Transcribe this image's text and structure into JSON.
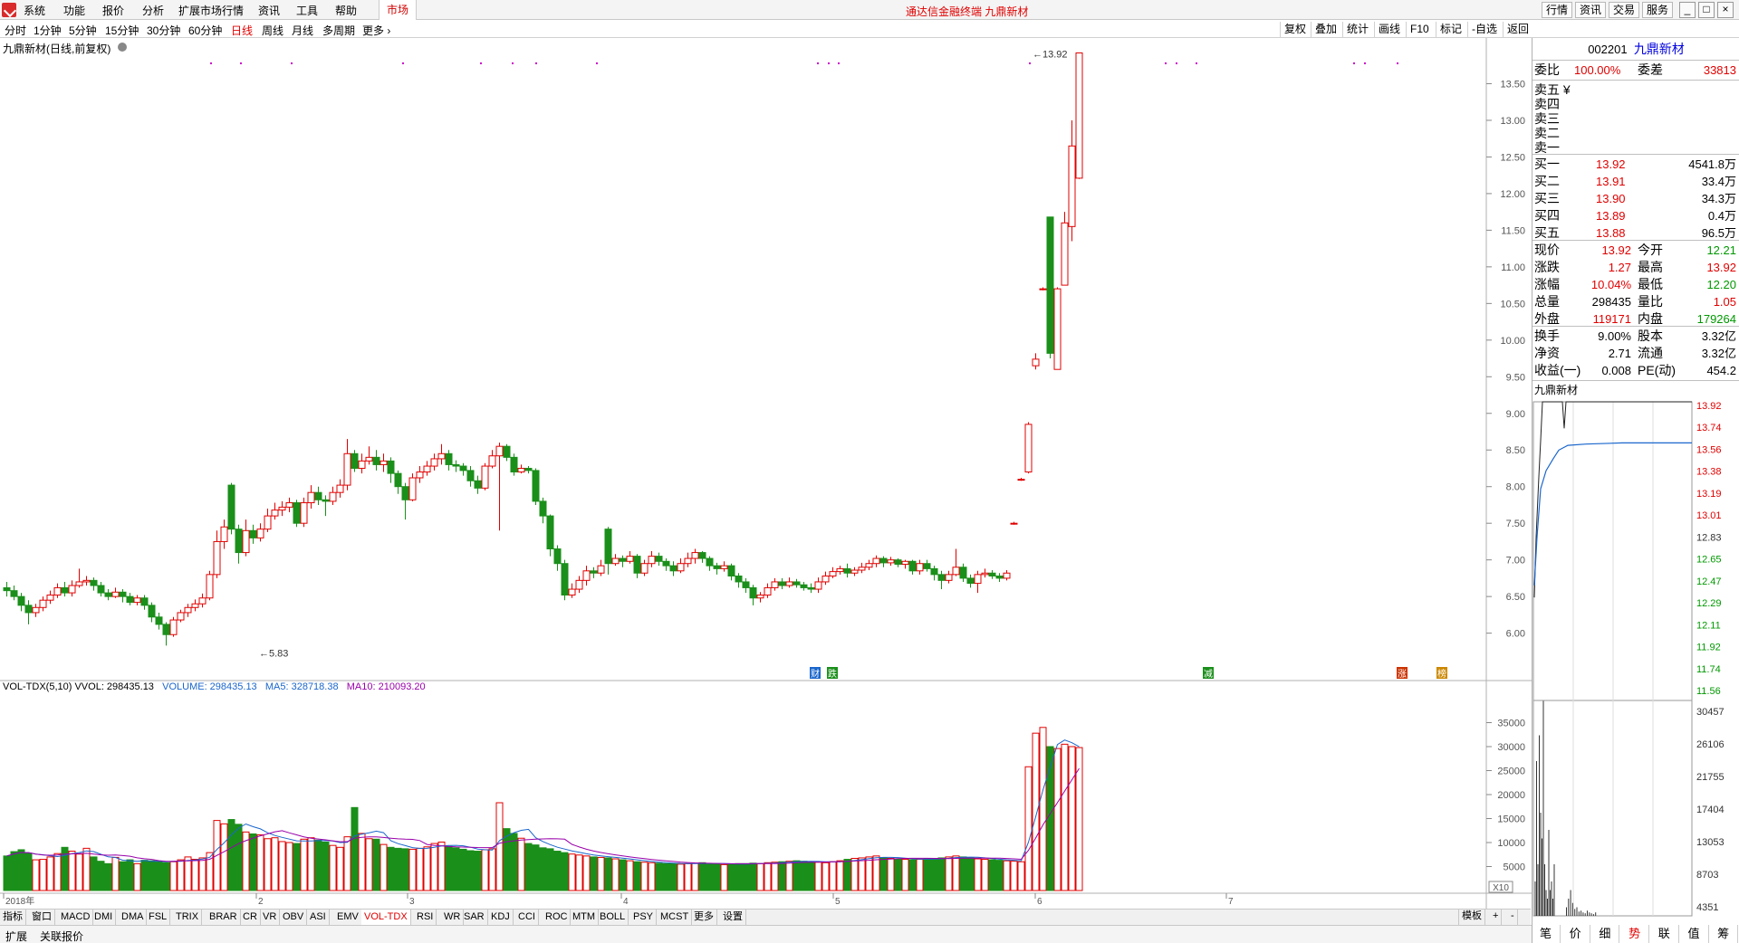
{
  "app": {
    "title": "通达信金融终端 九鼎新材",
    "menus": [
      "系统",
      "功能",
      "报价",
      "分析",
      "扩展市场行情",
      "资讯",
      "工具",
      "帮助"
    ],
    "market_tab": "市场",
    "top_buttons": [
      "行情",
      "资讯",
      "交易",
      "服务"
    ],
    "window_buttons": [
      "_",
      "□",
      "×"
    ]
  },
  "periods": [
    "分时",
    "1分钟",
    "5分钟",
    "15分钟",
    "30分钟",
    "60分钟",
    "日线",
    "周线",
    "月线",
    "多周期",
    "更多"
  ],
  "active_period": "日线",
  "right_tools": [
    "复权",
    "叠加",
    "统计",
    "画线",
    "F10",
    "标记",
    "-自选",
    "返回"
  ],
  "chart": {
    "title": "九鼎新材(日线,前复权)",
    "high_marker": "13.92",
    "low_marker": "5.83",
    "y_ticks": [
      "13.50",
      "13.00",
      "12.50",
      "12.00",
      "11.50",
      "11.00",
      "10.50",
      "10.00",
      "9.50",
      "9.00",
      "8.50",
      "8.00",
      "7.50",
      "7.00",
      "6.50",
      "6.00"
    ],
    "x_labels": [
      "2018年",
      "2",
      "3",
      "4",
      "5",
      "6",
      "7"
    ],
    "event_markers": [
      "财",
      "跌",
      "减",
      "涨",
      "榜"
    ],
    "up_color": "#e00000",
    "down_color": "#1a8f1a"
  },
  "volume": {
    "legend_name": "VOL-TDX(5,10) VVOL: 298435.13",
    "legend_volume": "VOLUME: 298435.13",
    "legend_ma5": "MA5: 328718.38",
    "legend_ma10": "MA10: 210093.20",
    "y_ticks": [
      "35000",
      "30000",
      "25000",
      "20000",
      "15000",
      "10000",
      "5000"
    ],
    "unit": "X10",
    "ma5_color": "#1a66cc",
    "ma10_color": "#9900aa"
  },
  "bottom_tabs": [
    "指标",
    "窗口",
    "MACD",
    "DMI",
    "DMA",
    "FSL",
    "TRIX",
    "BRAR",
    "CR",
    "VR",
    "OBV",
    "ASI",
    "EMV",
    "VOL-TDX",
    "RSI",
    "WR",
    "SAR",
    "KDJ",
    "CCI",
    "ROC",
    "MTM",
    "BOLL",
    "PSY",
    "MCST",
    "更多",
    "设置"
  ],
  "active_bottom_tab": "VOL-TDX",
  "bottom_right": [
    "模板",
    "+",
    "-"
  ],
  "status_tabs": [
    "扩展",
    "关联报价"
  ],
  "quote": {
    "code": "002201",
    "name": "九鼎新材",
    "webi_label": "委比",
    "webi": "100.00%",
    "weicha_label": "委差",
    "weicha": "33813",
    "asks": [
      {
        "label": "卖五",
        "extra": "¥"
      },
      {
        "label": "卖四"
      },
      {
        "label": "卖三"
      },
      {
        "label": "卖二"
      },
      {
        "label": "卖一"
      }
    ],
    "bids": [
      {
        "label": "买一",
        "price": "13.92",
        "vol": "4541.8万"
      },
      {
        "label": "买二",
        "price": "13.91",
        "vol": "33.4万"
      },
      {
        "label": "买三",
        "price": "13.90",
        "vol": "34.3万"
      },
      {
        "label": "买四",
        "price": "13.89",
        "vol": "0.4万"
      },
      {
        "label": "买五",
        "price": "13.88",
        "vol": "96.5万"
      }
    ],
    "stats": [
      {
        "l1": "现价",
        "v1": "13.92",
        "c1": "red",
        "l2": "今开",
        "v2": "12.21",
        "c2": "green"
      },
      {
        "l1": "涨跌",
        "v1": "1.27",
        "c1": "red",
        "l2": "最高",
        "v2": "13.92",
        "c2": "red"
      },
      {
        "l1": "涨幅",
        "v1": "10.04%",
        "c1": "red",
        "l2": "最低",
        "v2": "12.20",
        "c2": "green"
      },
      {
        "l1": "总量",
        "v1": "298435",
        "c1": "black",
        "l2": "量比",
        "v2": "1.05",
        "c2": "red"
      },
      {
        "l1": "外盘",
        "v1": "119171",
        "c1": "red",
        "l2": "内盘",
        "v2": "179264",
        "c2": "green"
      }
    ],
    "stats2": [
      {
        "l1": "换手",
        "v1": "9.00%",
        "l2": "股本",
        "v2": "3.32亿"
      },
      {
        "l1": "净资",
        "v1": "2.71",
        "l2": "流通",
        "v2": "3.32亿"
      },
      {
        "l1": "收益(一)",
        "v1": "0.008",
        "l2": "PE(动)",
        "v2": "454.2"
      }
    ]
  },
  "mini_chart": {
    "title": "九鼎新材",
    "price_ticks": [
      "13.92",
      "13.74",
      "13.56",
      "13.38",
      "13.19",
      "13.01",
      "12.83",
      "12.65",
      "12.47",
      "12.29",
      "12.11",
      "11.92",
      "11.74",
      "11.56"
    ],
    "vol_ticks": [
      "30457",
      "26106",
      "21755",
      "17404",
      "13053",
      "8703",
      "4351"
    ],
    "tabs": [
      "笔",
      "价",
      "细",
      "势",
      "联",
      "值",
      "筹"
    ],
    "active_tab": "势"
  },
  "chart_data": {
    "type": "candlestick",
    "title": "九鼎新材(日线,前复权)",
    "ylim": [
      5.6,
      14.0
    ],
    "candles": [
      [
        6.62,
        6.58,
        6.7,
        6.5
      ],
      [
        6.58,
        6.5,
        6.65,
        6.45
      ],
      [
        6.5,
        6.38,
        6.55,
        6.3
      ],
      [
        6.38,
        6.28,
        6.45,
        6.12
      ],
      [
        6.28,
        6.35,
        6.4,
        6.22
      ],
      [
        6.35,
        6.45,
        6.5,
        6.3
      ],
      [
        6.45,
        6.52,
        6.58,
        6.4
      ],
      [
        6.52,
        6.62,
        6.68,
        6.48
      ],
      [
        6.62,
        6.55,
        6.7,
        6.5
      ],
      [
        6.55,
        6.65,
        6.72,
        6.5
      ],
      [
        6.65,
        6.7,
        6.88,
        6.62
      ],
      [
        6.7,
        6.72,
        6.78,
        6.65
      ],
      [
        6.72,
        6.65,
        6.76,
        6.58
      ],
      [
        6.65,
        6.55,
        6.7,
        6.5
      ],
      [
        6.55,
        6.5,
        6.6,
        6.45
      ],
      [
        6.5,
        6.56,
        6.62,
        6.48
      ],
      [
        6.56,
        6.5,
        6.6,
        6.42
      ],
      [
        6.5,
        6.42,
        6.55,
        6.38
      ],
      [
        6.42,
        6.48,
        6.52,
        6.38
      ],
      [
        6.48,
        6.38,
        6.52,
        6.32
      ],
      [
        6.38,
        6.22,
        6.42,
        6.15
      ],
      [
        6.22,
        6.12,
        6.28,
        6.05
      ],
      [
        6.12,
        5.98,
        6.15,
        5.83
      ],
      [
        5.98,
        6.18,
        6.22,
        5.95
      ],
      [
        6.18,
        6.28,
        6.32,
        6.15
      ],
      [
        6.28,
        6.35,
        6.4,
        6.22
      ],
      [
        6.35,
        6.4,
        6.46,
        6.3
      ],
      [
        6.4,
        6.48,
        6.54,
        6.35
      ],
      [
        6.48,
        6.8,
        6.85,
        6.45
      ],
      [
        6.8,
        7.25,
        7.4,
        6.75
      ],
      [
        7.25,
        7.45,
        7.55,
        7.15
      ],
      [
        8.02,
        7.42,
        8.05,
        7.35
      ],
      [
        7.42,
        7.1,
        7.48,
        6.95
      ],
      [
        7.1,
        7.4,
        7.55,
        7.05
      ],
      [
        7.4,
        7.3,
        7.48,
        7.22
      ],
      [
        7.3,
        7.42,
        7.5,
        7.25
      ],
      [
        7.42,
        7.6,
        7.7,
        7.38
      ],
      [
        7.6,
        7.68,
        7.78,
        7.55
      ],
      [
        7.68,
        7.72,
        7.8,
        7.6
      ],
      [
        7.72,
        7.78,
        7.85,
        7.65
      ],
      [
        7.78,
        7.5,
        7.82,
        7.45
      ],
      [
        7.5,
        7.78,
        7.85,
        7.45
      ],
      [
        7.78,
        7.92,
        8.02,
        7.7
      ],
      [
        7.92,
        7.82,
        8.0,
        7.75
      ],
      [
        7.82,
        7.8,
        7.88,
        7.6
      ],
      [
        7.8,
        7.92,
        8.0,
        7.75
      ],
      [
        7.92,
        8.02,
        8.1,
        7.85
      ],
      [
        8.02,
        8.45,
        8.65,
        7.95
      ],
      [
        8.45,
        8.25,
        8.5,
        8.2
      ],
      [
        8.25,
        8.35,
        8.45,
        8.18
      ],
      [
        8.35,
        8.4,
        8.55,
        8.3
      ],
      [
        8.4,
        8.3,
        8.5,
        8.22
      ],
      [
        8.3,
        8.35,
        8.45,
        8.2
      ],
      [
        8.35,
        8.18,
        8.4,
        8.05
      ],
      [
        8.18,
        8.0,
        8.22,
        7.9
      ],
      [
        8.0,
        7.82,
        8.05,
        7.55
      ],
      [
        7.82,
        8.12,
        8.18,
        7.8
      ],
      [
        8.12,
        8.2,
        8.28,
        8.05
      ],
      [
        8.2,
        8.28,
        8.35,
        8.15
      ],
      [
        8.28,
        8.38,
        8.45,
        8.22
      ],
      [
        8.38,
        8.45,
        8.58,
        8.3
      ],
      [
        8.45,
        8.3,
        8.5,
        8.22
      ],
      [
        8.3,
        8.28,
        8.36,
        8.2
      ],
      [
        8.28,
        8.22,
        8.32,
        8.15
      ],
      [
        8.22,
        8.08,
        8.28,
        8.0
      ],
      [
        8.08,
        7.98,
        8.15,
        7.9
      ],
      [
        7.98,
        8.28,
        8.32,
        7.95
      ],
      [
        8.28,
        8.42,
        8.5,
        8.25
      ],
      [
        8.42,
        8.55,
        8.6,
        7.4
      ],
      [
        8.55,
        8.4,
        8.58,
        8.35
      ],
      [
        8.4,
        8.2,
        8.45,
        8.15
      ],
      [
        8.2,
        8.25,
        8.3,
        8.18
      ],
      [
        8.25,
        8.22,
        8.28,
        8.18
      ],
      [
        8.22,
        7.8,
        8.25,
        7.75
      ],
      [
        7.8,
        7.6,
        7.85,
        7.5
      ],
      [
        7.6,
        7.15,
        7.62,
        7.05
      ],
      [
        7.15,
        6.95,
        7.2,
        6.85
      ],
      [
        6.95,
        6.52,
        7.0,
        6.45
      ],
      [
        6.52,
        6.6,
        6.68,
        6.48
      ],
      [
        6.6,
        6.72,
        6.78,
        6.55
      ],
      [
        6.72,
        6.85,
        6.92,
        6.65
      ],
      [
        6.85,
        6.82,
        6.9,
        6.75
      ],
      [
        6.82,
        6.92,
        7.0,
        6.78
      ],
      [
        7.42,
        6.95,
        7.45,
        6.8
      ],
      [
        6.95,
        7.02,
        7.08,
        6.92
      ],
      [
        7.02,
        6.98,
        7.06,
        6.9
      ],
      [
        6.98,
        7.05,
        7.12,
        6.95
      ],
      [
        7.05,
        6.82,
        7.08,
        6.75
      ],
      [
        6.82,
        6.95,
        7.0,
        6.78
      ],
      [
        6.95,
        7.05,
        7.12,
        6.9
      ],
      [
        7.05,
        6.98,
        7.1,
        6.92
      ],
      [
        6.98,
        6.92,
        7.02,
        6.85
      ],
      [
        6.92,
        6.85,
        6.98,
        6.78
      ],
      [
        6.85,
        6.95,
        7.02,
        6.82
      ],
      [
        6.95,
        7.02,
        7.1,
        6.9
      ],
      [
        7.02,
        7.1,
        7.15,
        6.95
      ],
      [
        7.1,
        7.02,
        7.12,
        6.96
      ],
      [
        7.02,
        6.92,
        7.05,
        6.85
      ],
      [
        6.92,
        6.88,
        6.96,
        6.8
      ],
      [
        6.88,
        6.92,
        6.98,
        6.84
      ],
      [
        6.92,
        6.78,
        6.95,
        6.72
      ],
      [
        6.78,
        6.7,
        6.82,
        6.62
      ],
      [
        6.7,
        6.62,
        6.75,
        6.55
      ],
      [
        6.62,
        6.48,
        6.66,
        6.38
      ],
      [
        6.48,
        6.52,
        6.56,
        6.42
      ],
      [
        6.52,
        6.62,
        6.68,
        6.48
      ],
      [
        6.62,
        6.7,
        6.75,
        6.58
      ],
      [
        6.7,
        6.65,
        6.75,
        6.6
      ],
      [
        6.65,
        6.7,
        6.76,
        6.62
      ],
      [
        6.7,
        6.66,
        6.74,
        6.62
      ],
      [
        6.66,
        6.62,
        6.7,
        6.58
      ],
      [
        6.62,
        6.6,
        6.68,
        6.55
      ],
      [
        6.6,
        6.7,
        6.76,
        6.55
      ],
      [
        6.7,
        6.78,
        6.84,
        6.66
      ],
      [
        6.78,
        6.84,
        6.9,
        6.75
      ],
      [
        6.84,
        6.88,
        6.92,
        6.8
      ],
      [
        6.88,
        6.82,
        6.95,
        6.76
      ],
      [
        6.82,
        6.86,
        6.9,
        6.78
      ],
      [
        6.86,
        6.9,
        6.96,
        6.82
      ],
      [
        6.9,
        6.95,
        7.0,
        6.86
      ],
      [
        6.95,
        7.02,
        7.06,
        6.9
      ],
      [
        7.02,
        6.96,
        7.05,
        6.9
      ],
      [
        6.96,
        7.0,
        7.04,
        6.92
      ],
      [
        7.0,
        6.94,
        7.02,
        6.9
      ],
      [
        6.94,
        6.98,
        7.0,
        6.88
      ],
      [
        6.98,
        6.85,
        7.0,
        6.8
      ],
      [
        6.85,
        6.95,
        7.0,
        6.8
      ],
      [
        6.95,
        6.88,
        7.0,
        6.84
      ],
      [
        6.88,
        6.8,
        6.92,
        6.72
      ],
      [
        6.8,
        6.72,
        6.85,
        6.6
      ],
      [
        6.72,
        6.8,
        6.85,
        6.68
      ],
      [
        6.8,
        6.9,
        7.15,
        6.78
      ],
      [
        6.9,
        6.75,
        6.95,
        6.7
      ],
      [
        6.75,
        6.68,
        6.8,
        6.62
      ],
      [
        6.68,
        6.8,
        6.85,
        6.55
      ],
      [
        6.8,
        6.82,
        6.88,
        6.76
      ],
      [
        6.82,
        6.78,
        6.86,
        6.74
      ],
      [
        6.78,
        6.75,
        6.82,
        6.7
      ],
      [
        6.75,
        6.82,
        6.86,
        6.72
      ],
      [
        7.5,
        7.5,
        7.52,
        7.48
      ],
      [
        8.1,
        8.1,
        8.12,
        8.08
      ],
      [
        8.2,
        8.85,
        8.88,
        8.18
      ],
      [
        9.65,
        9.74,
        9.82,
        9.6
      ],
      [
        10.7,
        10.7,
        10.72,
        10.68
      ],
      [
        11.68,
        9.82,
        11.68,
        9.75
      ],
      [
        9.6,
        10.7,
        10.72,
        9.6
      ],
      [
        10.75,
        11.6,
        11.75,
        11.2
      ],
      [
        11.55,
        12.65,
        13.0,
        11.35
      ],
      [
        12.21,
        13.92,
        13.92,
        12.2
      ]
    ],
    "volume": [
      720,
      810,
      850,
      780,
      640,
      650,
      700,
      770,
      900,
      820,
      760,
      880,
      700,
      610,
      560,
      690,
      600,
      640,
      560,
      630,
      620,
      610,
      580,
      600,
      640,
      700,
      650,
      680,
      790,
      1460,
      1390,
      1480,
      1380,
      1220,
      1180,
      1160,
      1080,
      1100,
      1020,
      1000,
      980,
      1070,
      1100,
      1050,
      1010,
      940,
      900,
      1120,
      1730,
      1190,
      1080,
      1070,
      960,
      900,
      880,
      870,
      860,
      880,
      910,
      980,
      1010,
      920,
      890,
      860,
      830,
      820,
      850,
      870,
      1830,
      1290,
      1190,
      1090,
      980,
      950,
      890,
      870,
      820,
      790,
      760,
      740,
      720,
      700,
      690,
      680,
      660,
      640,
      620,
      600,
      590,
      580,
      570,
      560,
      560,
      550,
      560,
      570,
      580,
      560,
      550,
      540,
      550,
      560,
      560,
      570,
      560,
      580,
      590,
      600,
      610,
      620,
      610,
      600,
      590,
      580,
      600,
      620,
      650,
      670,
      680,
      700,
      720,
      680,
      670,
      660,
      650,
      640,
      650,
      660,
      670,
      680,
      700,
      720,
      700,
      680,
      660,
      650,
      640,
      630,
      620,
      610,
      600,
      2580,
      3280,
      3400,
      3000,
      2960,
      3050,
      3000,
      2980
    ],
    "vol_ylim": [
      0,
      40000
    ],
    "vol_scale_note": "X10"
  }
}
